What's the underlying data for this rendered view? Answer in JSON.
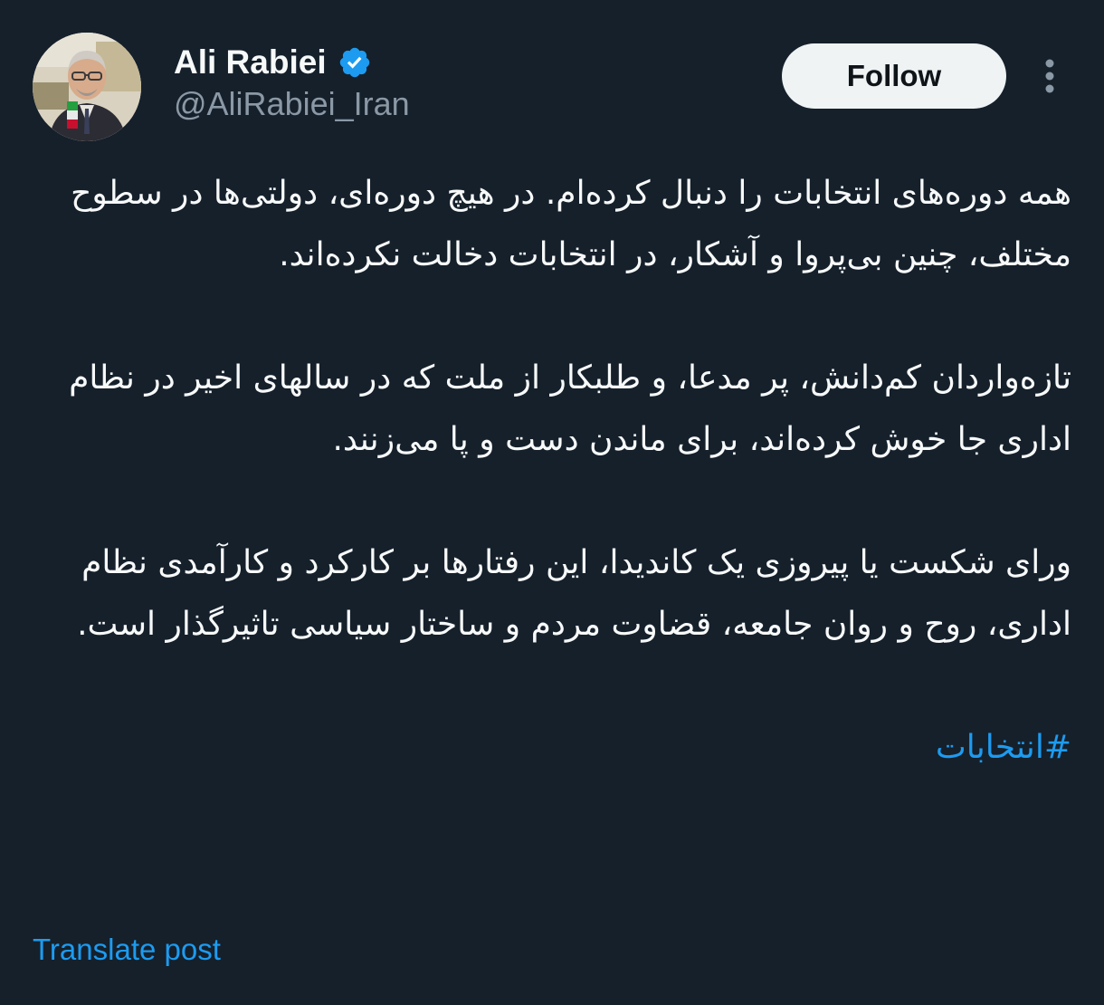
{
  "theme": {
    "background": "#15202b",
    "text": "#f7f9f9",
    "muted": "#8b98a5",
    "accent": "#1d9bf0",
    "button_bg": "#eff3f4"
  },
  "author": {
    "name": "Ali Rabiei",
    "handle": "@AliRabiei_Iran",
    "verified_icon": "verified-badge-icon",
    "avatar_icon": "profile-photo"
  },
  "actions": {
    "follow_label": "Follow",
    "more_icon": "more-vertical-icon"
  },
  "post": {
    "paragraphs": [
      "همه دوره‌های انتخابات را دنبال کرده‌ام. در هیچ دوره‌ای، دولتی‌ها در سطوح مختلف، چنین بی‌پروا و آشکار، در انتخابات دخالت نکرده‌اند.",
      "تازه‌واردان کم‌دانش، پر مدعا، و طلبکار از ملت که در سالهای اخیر در نظام اداری جا خوش کرده‌اند، برای ماندن دست و پا می‌زنند.",
      "ورای شکست یا پیروزی یک کاندیدا، این رفتارها بر کارکرد و کارآمدی نظام اداری، روح و روان جامعه، قضاوت مردم و ساختار سیاسی تاثیرگذار است."
    ],
    "hashtag": "#انتخابات"
  },
  "footer": {
    "translate_label": "Translate post"
  }
}
